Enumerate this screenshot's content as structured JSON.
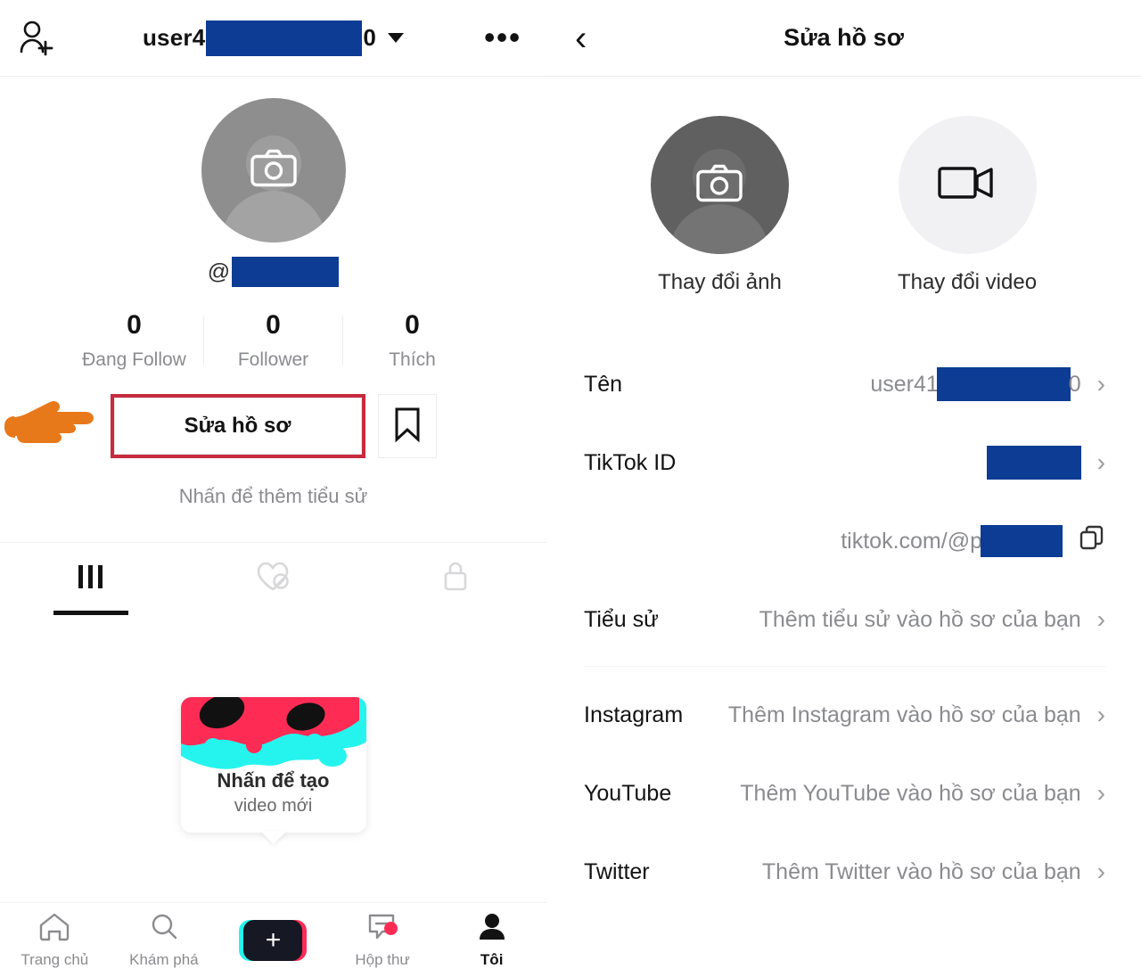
{
  "left": {
    "header": {
      "add_friend_icon": "person-add-icon",
      "username_prefix": "user4",
      "username_suffix": "0",
      "dropdown_icon": "chevron-down-icon",
      "more_icon": "more-options-icon"
    },
    "avatar": {
      "icon": "camera-icon"
    },
    "handle": {
      "at": "@"
    },
    "stats": [
      {
        "num": "0",
        "label": "Đang Follow"
      },
      {
        "num": "0",
        "label": "Follower"
      },
      {
        "num": "0",
        "label": "Thích"
      }
    ],
    "actions": {
      "pointer_icon": "pointing-hand-icon",
      "edit_profile_label": "Sửa hồ sơ",
      "bookmark_icon": "bookmark-icon",
      "highlight_color": "#c62b3e"
    },
    "bio_hint": "Nhấn để thêm tiểu sử",
    "tabs": [
      {
        "icon": "grid-posts-icon",
        "active": true
      },
      {
        "icon": "liked-hidden-icon",
        "active": false
      },
      {
        "icon": "lock-private-icon",
        "active": false
      }
    ],
    "create_card": {
      "line1": "Nhấn để tạo",
      "line2": "video mới"
    },
    "bottom_nav": [
      {
        "icon": "home-icon",
        "label": "Trang chủ",
        "active": false
      },
      {
        "icon": "search-icon",
        "label": "Khám phá",
        "active": false
      },
      {
        "icon": "plus-create-icon",
        "label": "",
        "active": false
      },
      {
        "icon": "inbox-icon",
        "label": "Hộp thư",
        "active": false
      },
      {
        "icon": "profile-person-icon",
        "label": "Tôi",
        "active": true
      }
    ]
  },
  "right": {
    "header": {
      "back_icon": "back-chevron-icon",
      "title": "Sửa hồ sơ"
    },
    "media": [
      {
        "icon": "camera-icon",
        "label": "Thay đổi ảnh"
      },
      {
        "icon": "video-camera-icon",
        "label": "Thay đổi video"
      }
    ],
    "rows": [
      {
        "label": "Tên",
        "value_prefix": "user41",
        "value_suffix": "0",
        "chevron": "›"
      },
      {
        "label": "TikTok ID",
        "value_prefix": "",
        "value_suffix": "",
        "chevron": "›"
      },
      {
        "label": "",
        "value_prefix": "tiktok.com/@p",
        "value_suffix": "",
        "copy_icon": "copy-icon"
      },
      {
        "label": "Tiểu sử",
        "value": "Thêm tiểu sử vào hồ sơ của bạn",
        "chevron": "›"
      },
      {
        "label": "Instagram",
        "value": "Thêm Instagram vào hồ sơ của bạn",
        "chevron": "›"
      },
      {
        "label": "YouTube",
        "value": "Thêm YouTube vào hồ sơ của bạn",
        "chevron": "›"
      },
      {
        "label": "Twitter",
        "value": "Thêm Twitter vào hồ sơ của bạn",
        "chevron": "›"
      }
    ]
  },
  "colors": {
    "redaction": "#0c3c94",
    "highlight": "#c62b3e",
    "accent_cyan": "#25f4ee",
    "accent_pink": "#fe2c55",
    "dark": "#161823"
  }
}
